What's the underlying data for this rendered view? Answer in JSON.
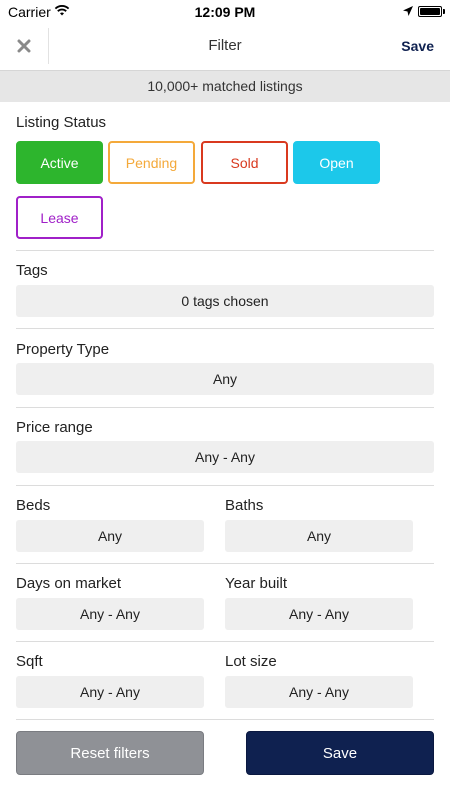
{
  "status_bar": {
    "carrier": "Carrier",
    "time": "12:09 PM"
  },
  "nav": {
    "close_icon": "close-icon",
    "title": "Filter",
    "save_label": "Save"
  },
  "banner": {
    "text": "10,000+ matched listings"
  },
  "listing_status": {
    "label": "Listing Status",
    "chips": [
      {
        "label": "Active",
        "color": "#2db52d",
        "filled": true
      },
      {
        "label": "Pending",
        "color": "#f4a93a",
        "filled": false
      },
      {
        "label": "Sold",
        "color": "#d9391f",
        "filled": false
      },
      {
        "label": "Open",
        "color": "#1cc8ea",
        "filled": true
      },
      {
        "label": "Lease",
        "color": "#a020c8",
        "filled": false
      }
    ]
  },
  "tags": {
    "label": "Tags",
    "value": "0 tags chosen"
  },
  "property_type": {
    "label": "Property Type",
    "value": "Any"
  },
  "price_range": {
    "label": "Price range",
    "value": "Any - Any"
  },
  "beds": {
    "label": "Beds",
    "value": "Any"
  },
  "baths": {
    "label": "Baths",
    "value": "Any"
  },
  "days_on_market": {
    "label": "Days on market",
    "value": "Any - Any"
  },
  "year_built": {
    "label": "Year built",
    "value": "Any - Any"
  },
  "sqft": {
    "label": "Sqft",
    "value": "Any - Any"
  },
  "lot_size": {
    "label": "Lot size",
    "value": "Any - Any"
  },
  "footer": {
    "reset_label": "Reset filters",
    "save_label": "Save"
  },
  "colors": {
    "navy": "#0f2150",
    "gray_button": "#8f9196"
  }
}
